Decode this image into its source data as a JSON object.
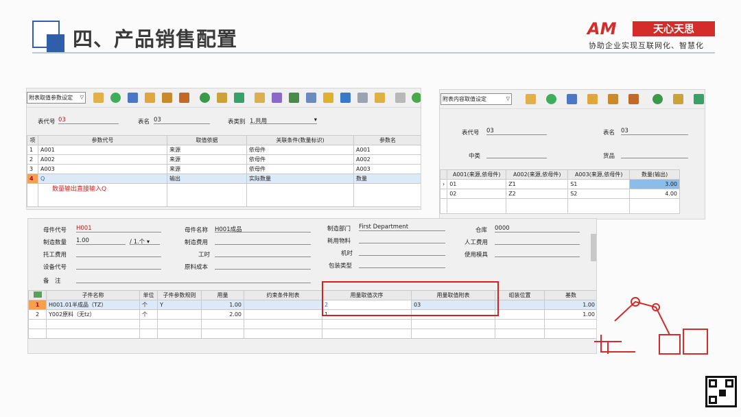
{
  "header": {
    "title": "四、产品销售配置",
    "logo_am": "AM",
    "logo_cn": "天心天思",
    "slogan": "协助企业实现互联网化、智慧化"
  },
  "p1": {
    "combo": "附表取值参数设定",
    "code_label": "表代号",
    "code": "03",
    "name_label": "表名",
    "name": "03",
    "type_label": "表类别",
    "type": "1.共用",
    "cols": [
      "项",
      "参数代号",
      "取值依据",
      "关联条件(数量标识)",
      "参数名"
    ],
    "rows": [
      [
        "1",
        "A001",
        "来源",
        "依母件",
        "A001"
      ],
      [
        "2",
        "A002",
        "来源",
        "依母件",
        "A002"
      ],
      [
        "3",
        "A003",
        "来源",
        "依母件",
        "A003"
      ],
      [
        "4",
        "Q",
        "输出",
        "实际数量",
        "数量"
      ]
    ],
    "note": "数量输出直接输入Q"
  },
  "p2": {
    "combo": "附表内容取值设定",
    "code_label": "表代号",
    "code": "03",
    "name_label": "表名",
    "name": "03",
    "mid_label": "中类",
    "goods_label": "货品",
    "cols": [
      "A001(来源,依母件)",
      "A002(来源,依母件)",
      "A003(来源,依母件)",
      "数量(输出)"
    ],
    "rows": [
      [
        "01",
        "Z1",
        "S1",
        "3.00"
      ],
      [
        "02",
        "Z2",
        "S2",
        "4.00"
      ]
    ]
  },
  "p3": {
    "parent_code_label": "母件代号",
    "parent_code": "H001",
    "parent_name_label": "母件名称",
    "parent_name": "H001成品",
    "dept_label": "制造部门",
    "dept": "First Department",
    "store_label": "仓库",
    "store": "0000",
    "qty_label": "制造数量",
    "qty": "1.00",
    "unit": "/ 1.个",
    "cost_label": "制造费用",
    "material_label": "耗用物料",
    "labor_label": "人工费用",
    "outsource_label": "托工费用",
    "hours_label": "工时",
    "machine_label": "机时",
    "mold_label": "使用模具",
    "equip_label": "设备代号",
    "raw_label": "原料成本",
    "pack_label": "包装类型",
    "remark_label": "备　注",
    "cols": [
      "子件名称",
      "单位",
      "子件参数规则",
      "用量",
      "约束条件附表",
      "用量取值次序",
      "用量取值附表",
      "组装位置",
      "基数"
    ],
    "rows": [
      [
        "1",
        "H001.01半成品（TZ）",
        "个",
        "Y",
        "1.00",
        "",
        "2",
        "03",
        "",
        "1.00"
      ],
      [
        "2",
        "Y002原料（无tz）",
        "个",
        "",
        "2.00",
        "",
        "1",
        "",
        "",
        "1.00"
      ]
    ]
  }
}
